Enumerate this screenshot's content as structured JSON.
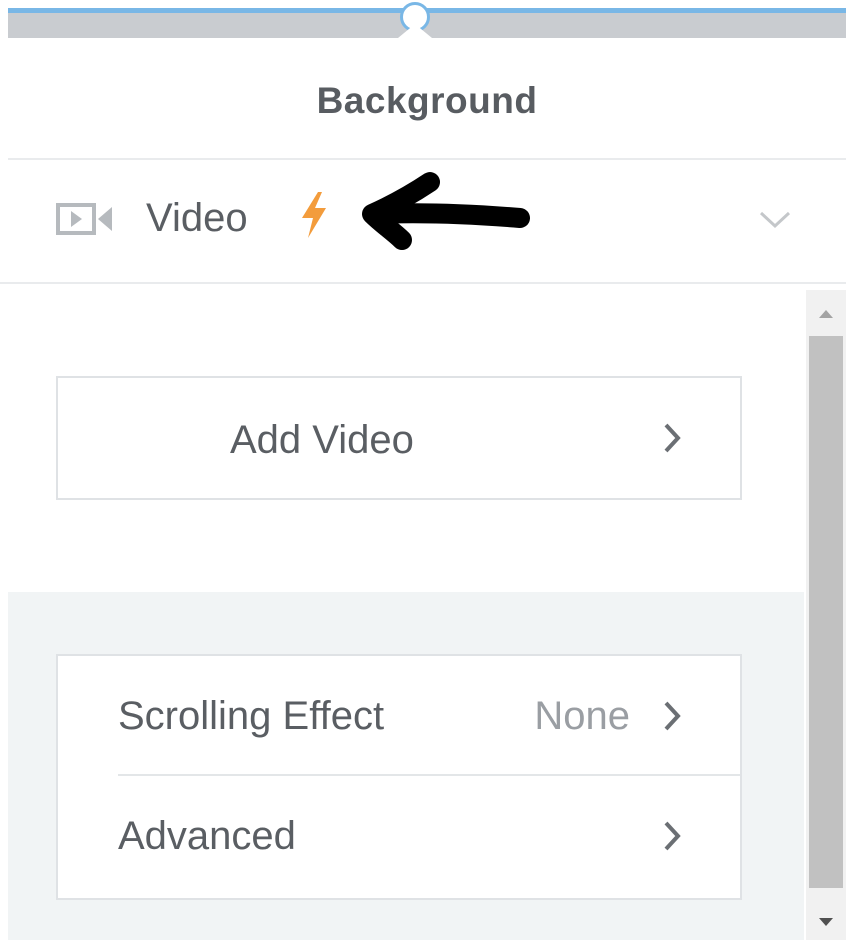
{
  "panel": {
    "title": "Background"
  },
  "section": {
    "label": "Video",
    "icon": "video-camera-icon",
    "badge_icon": "lightning-bolt-icon",
    "badge_color": "#f39c3c",
    "expand_icon": "chevron-down-icon"
  },
  "add_video": {
    "label": "Add Video",
    "icon": "chevron-right-icon"
  },
  "settings": [
    {
      "label": "Scrolling Effect",
      "value": "None"
    },
    {
      "label": "Advanced",
      "value": ""
    }
  ],
  "annotation": {
    "icon": "hand-drawn-arrow-icon",
    "color": "#000000"
  }
}
